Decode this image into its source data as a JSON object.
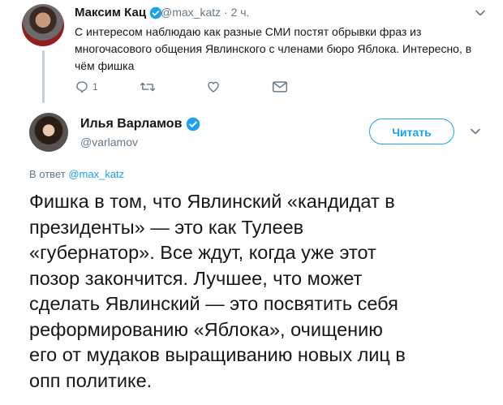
{
  "parent_tweet": {
    "author_name": "Максим Кац",
    "handle": "@max_katz",
    "time": "2 ч.",
    "text_lines": [
      "С интересом наблюдаю как разные СМИ постят обрывки фраз из",
      "многочасового общения Явлинского с членами бюро Яблока. Интересно, в",
      "чём фишка"
    ],
    "reply_count": "1"
  },
  "main_tweet": {
    "author_name": "Илья Варламов",
    "handle": "@varlamov",
    "follow_label": "Читать",
    "reply_prefix": "В ответ",
    "reply_handle": "@max_katz",
    "text_lines": [
      "Фишка в том, что Явлинский «кандидат в",
      "президенты» — это как Тулеев",
      "«губернатор». Все ждут, когда уже этот",
      "позор закончится. Лучшее, что может",
      "сделать Явлинский — это посвятить себя",
      "реформированию «Яблока», очищению",
      "его от мудаков выращиванию новых лиц в",
      "опп политике."
    ]
  },
  "colors": {
    "accent": "#1da1f2",
    "secondary_text": "#657786",
    "primary_text": "#14171a"
  }
}
